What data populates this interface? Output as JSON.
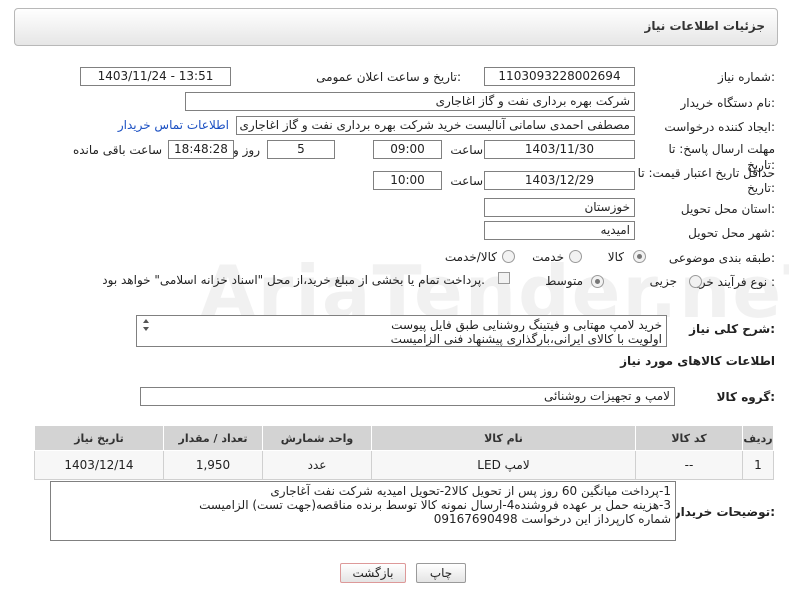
{
  "header": {
    "title": "جزئیات اطلاعات نیاز"
  },
  "form": {
    "need_number_label": "شماره نیاز:",
    "need_number": "1103093228002694",
    "announce_label": "تاریخ و ساعت اعلان عمومی:",
    "announce_value": "1403/11/24 - 13:51",
    "buyer_org_label": "نام دستگاه خریدار:",
    "buyer_org": "شرکت بهره برداری نفت و گاز اغاجاری",
    "creator_label": "ایجاد کننده درخواست:",
    "creator": "مصطفی احمدی سامانی آنالیست خرید شرکت بهره برداری نفت و گاز اغاجاری",
    "contact_link": "اطلاعات تماس خریدار",
    "deadline_label_1": "مهلت ارسال پاسخ: تا",
    "deadline_label_2": "تاریخ:",
    "deadline_date": "1403/11/30",
    "time_label": "ساعت",
    "deadline_time": "09:00",
    "days_value": "5",
    "days_label": "روز و",
    "remaining_time": "18:48:28",
    "remaining_label": "ساعت باقی مانده",
    "validity_label_1": "حداقل تاریخ اعتبار قیمت: تا",
    "validity_label_2": "تاریخ:",
    "validity_date": "1403/12/29",
    "validity_time_label": "ساعت",
    "validity_time": "10:00",
    "province_label": "استان محل تحویل:",
    "province": "خوزستان",
    "city_label": "شهر محل تحویل:",
    "city": "امیدیه",
    "category_label": "طبقه بندی موضوعی:",
    "category_options": [
      "کالا",
      "خدمت",
      "کالا/خدمت"
    ],
    "process_label": "نوع فرآیند خرید :",
    "process_options": [
      "جزیی",
      "متوسط"
    ],
    "payment_note": "پرداخت تمام یا بخشی از مبلغ خرید،از محل \"اسناد خزانه اسلامی\" خواهد بود."
  },
  "description": {
    "label": "شرح کلی نیاز:",
    "line1": "خرید لامپ مهتابی و فیتینگ روشنایی طبق فایل پیوست",
    "line2": "اولویت با کالای ایرانی،بارگذاری پیشنهاد فنی الزامیست"
  },
  "goods_section": {
    "title": "اطلاعات کالاهای مورد نیاز",
    "group_label": "گروه کالا:",
    "group_value": "لامپ و تجهیزات روشنائی"
  },
  "table": {
    "headers": [
      "ردیف",
      "کد کالا",
      "نام کالا",
      "واحد شمارش",
      "تعداد / مقدار",
      "تاریخ نیاز"
    ],
    "rows": [
      [
        "1",
        "--",
        "لامپ LED",
        "عدد",
        "1,950",
        "1403/12/14"
      ]
    ]
  },
  "notes": {
    "label": "توضیحات خریدار:",
    "line1": "1-پرداخت میانگین 60 روز پس از تحویل کالا2-تحویل امیدیه شرکت نفت آغاجاری",
    "line2": "3-هزینه حمل بر عهده فروشنده4-ارسال نمونه کالا توسط برنده مناقصه(جهت تست) الزامیست",
    "line3": "شماره کارپرداز این درخواست 09167690498"
  },
  "buttons": {
    "print": "چاپ",
    "back": "بازگشت"
  },
  "watermark": "AriaTender.neT"
}
